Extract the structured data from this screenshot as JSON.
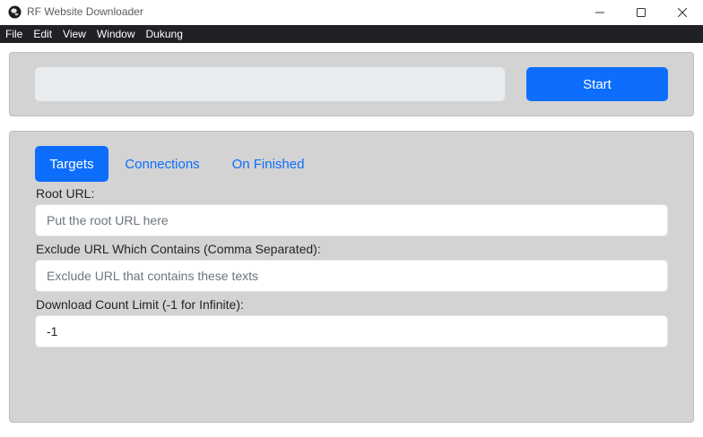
{
  "window": {
    "title": "RF Website Downloader",
    "icon": "app-globe-icon",
    "controls": [
      "minimize-icon",
      "maximize-icon",
      "close-icon"
    ]
  },
  "menu": [
    "File",
    "Edit",
    "View",
    "Window",
    "Dukung"
  ],
  "toolbar": {
    "url_value": "",
    "start_label": "Start"
  },
  "tabs": [
    {
      "label": "Targets",
      "active": true
    },
    {
      "label": "Connections",
      "active": false
    },
    {
      "label": "On Finished",
      "active": false
    }
  ],
  "form": {
    "root_url": {
      "label": "Root URL:",
      "placeholder": "Put the root URL here",
      "value": ""
    },
    "exclude": {
      "label": "Exclude URL Which Contains (Comma Separated):",
      "placeholder": "Exclude URL that contains these texts",
      "value": ""
    },
    "count": {
      "label": "Download Count Limit (-1 for Infinite):",
      "placeholder": "",
      "value": "-1"
    }
  },
  "colors": {
    "accent": "#0d6efd",
    "panel": "#d3d3d3",
    "menubar": "#202124"
  }
}
